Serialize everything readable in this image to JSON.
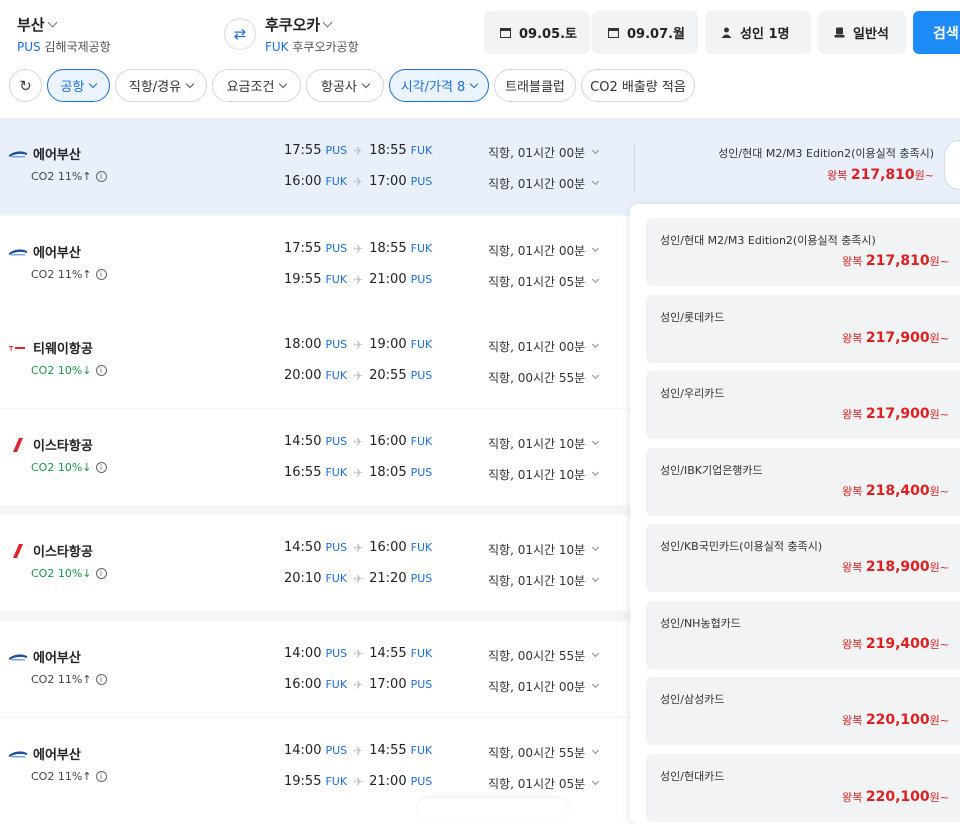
{
  "header": {
    "origin": {
      "city": "부산",
      "code": "PUS",
      "airport": "김해국제공항"
    },
    "destination": {
      "city": "후쿠오카",
      "code": "FUK",
      "airport": "후쿠오카공항"
    },
    "depart_date": "09.05.토",
    "return_date": "09.07.월",
    "passengers": "성인 1명",
    "cabin": "일반석",
    "search_label": "검색"
  },
  "filters": [
    "공항",
    "직항/경유",
    "요금조건",
    "항공사",
    "시각/가격 8",
    "트래블클럽",
    "CO2 배출량 적음"
  ],
  "flights": [
    {
      "airline": "에어부산",
      "co2": "CO2 11%↑",
      "co2_good": false,
      "out": {
        "dep": "17:55",
        "dep_code": "PUS",
        "arr": "18:55",
        "arr_code": "FUK",
        "dur": "직항, 01시간 00분"
      },
      "ret": {
        "dep": "16:00",
        "dep_code": "FUK",
        "arr": "17:00",
        "arr_code": "PUS",
        "dur": "직항, 01시간 00분"
      }
    },
    {
      "airline": "에어부산",
      "co2": "CO2 11%↑",
      "co2_good": false,
      "out": {
        "dep": "17:55",
        "dep_code": "PUS",
        "arr": "18:55",
        "arr_code": "FUK",
        "dur": "직항, 01시간 00분"
      },
      "ret": {
        "dep": "19:55",
        "dep_code": "FUK",
        "arr": "21:00",
        "arr_code": "PUS",
        "dur": "직항, 01시간 05분"
      }
    },
    {
      "airline": "티웨이항공",
      "co2": "CO2 10%↓",
      "co2_good": true,
      "out": {
        "dep": "18:00",
        "dep_code": "PUS",
        "arr": "19:00",
        "arr_code": "FUK",
        "dur": "직항, 01시간 00분"
      },
      "ret": {
        "dep": "20:00",
        "dep_code": "FUK",
        "arr": "20:55",
        "arr_code": "PUS",
        "dur": "직항, 00시간 55분"
      }
    },
    {
      "airline": "이스타항공",
      "co2": "CO2 10%↓",
      "co2_good": true,
      "out": {
        "dep": "14:50",
        "dep_code": "PUS",
        "arr": "16:00",
        "arr_code": "FUK",
        "dur": "직항, 01시간 10분"
      },
      "ret": {
        "dep": "16:55",
        "dep_code": "FUK",
        "arr": "18:05",
        "arr_code": "PUS",
        "dur": "직항, 01시간 10분"
      }
    },
    {
      "airline": "이스타항공",
      "co2": "CO2 10%↓",
      "co2_good": true,
      "out": {
        "dep": "14:50",
        "dep_code": "PUS",
        "arr": "16:00",
        "arr_code": "FUK",
        "dur": "직항, 01시간 10분"
      },
      "ret": {
        "dep": "20:10",
        "dep_code": "FUK",
        "arr": "21:20",
        "arr_code": "PUS",
        "dur": "직항, 01시간 10분"
      }
    },
    {
      "airline": "에어부산",
      "co2": "CO2 11%↑",
      "co2_good": false,
      "out": {
        "dep": "14:00",
        "dep_code": "PUS",
        "arr": "14:55",
        "arr_code": "FUK",
        "dur": "직항, 00시간 55분"
      },
      "ret": {
        "dep": "16:00",
        "dep_code": "FUK",
        "arr": "17:00",
        "arr_code": "PUS",
        "dur": "직항, 01시간 00분"
      }
    },
    {
      "airline": "에어부산",
      "co2": "CO2 11%↑",
      "co2_good": false,
      "out": {
        "dep": "14:00",
        "dep_code": "PUS",
        "arr": "14:55",
        "arr_code": "FUK",
        "dur": "직항, 00시간 55분"
      },
      "ret": {
        "dep": "19:55",
        "dep_code": "FUK",
        "arr": "21:00",
        "arr_code": "PUS",
        "dur": "직항, 01시간 05분"
      }
    }
  ],
  "best_price": {
    "plan": "성인/현대 M2/M3 Edition2(이용실적 충족시)",
    "prefix": "왕복",
    "amount": "217,810",
    "suffix": "원~"
  },
  "price_options": [
    {
      "plan": "성인/현대 M2/M3 Edition2(이용실적 충족시)",
      "prefix": "왕복",
      "amount": "217,810",
      "suffix": "원~"
    },
    {
      "plan": "성인/롯데카드",
      "prefix": "왕복",
      "amount": "217,900",
      "suffix": "원~"
    },
    {
      "plan": "성인/우리카드",
      "prefix": "왕복",
      "amount": "217,900",
      "suffix": "원~"
    },
    {
      "plan": "성인/IBK기업은행카드",
      "prefix": "왕복",
      "amount": "218,400",
      "suffix": "원~"
    },
    {
      "plan": "성인/KB국민카드(이용실적 충족시)",
      "prefix": "왕복",
      "amount": "218,900",
      "suffix": "원~"
    },
    {
      "plan": "성인/NH농협카드",
      "prefix": "왕복",
      "amount": "219,400",
      "suffix": "원~"
    },
    {
      "plan": "성인/삼성카드",
      "prefix": "왕복",
      "amount": "220,100",
      "suffix": "원~"
    },
    {
      "plan": "성인/현대카드",
      "prefix": "왕복",
      "amount": "220,100",
      "suffix": "원~"
    }
  ],
  "colors": {
    "accent": "#1d6fe0",
    "price": "#e02020",
    "co2_good": "#1a9a49",
    "selected_row": "#e9f0fb"
  }
}
